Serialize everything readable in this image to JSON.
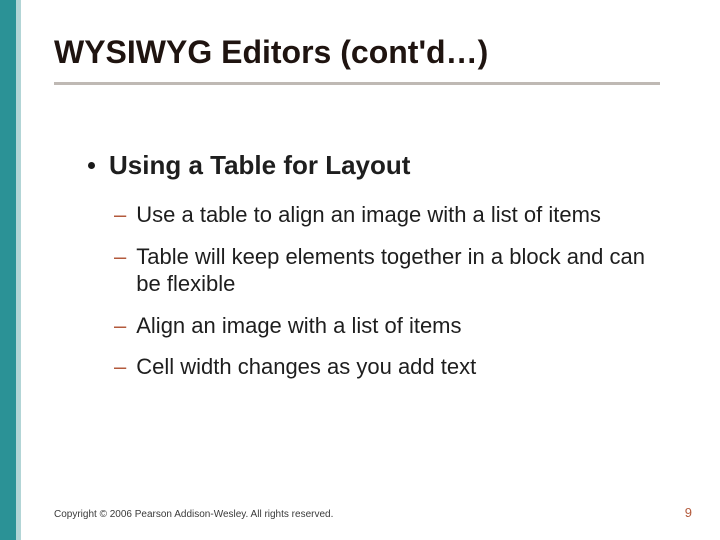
{
  "title": "WYSIWYG Editors (cont'd…)",
  "bullet": {
    "heading": "Using a Table for Layout",
    "items": [
      "Use a table to align an image with a list of items",
      "Table will keep elements together in a block and can be flexible",
      "Align an image with a list of items",
      "Cell width changes as you add text"
    ]
  },
  "footer": "Copyright © 2006 Pearson Addison-Wesley. All rights reserved.",
  "page_number": "9",
  "colors": {
    "teal": "#2b9296",
    "teal_light": "#b2d5d6",
    "dash": "#b35a3c",
    "rule": "#bfb9b4"
  }
}
